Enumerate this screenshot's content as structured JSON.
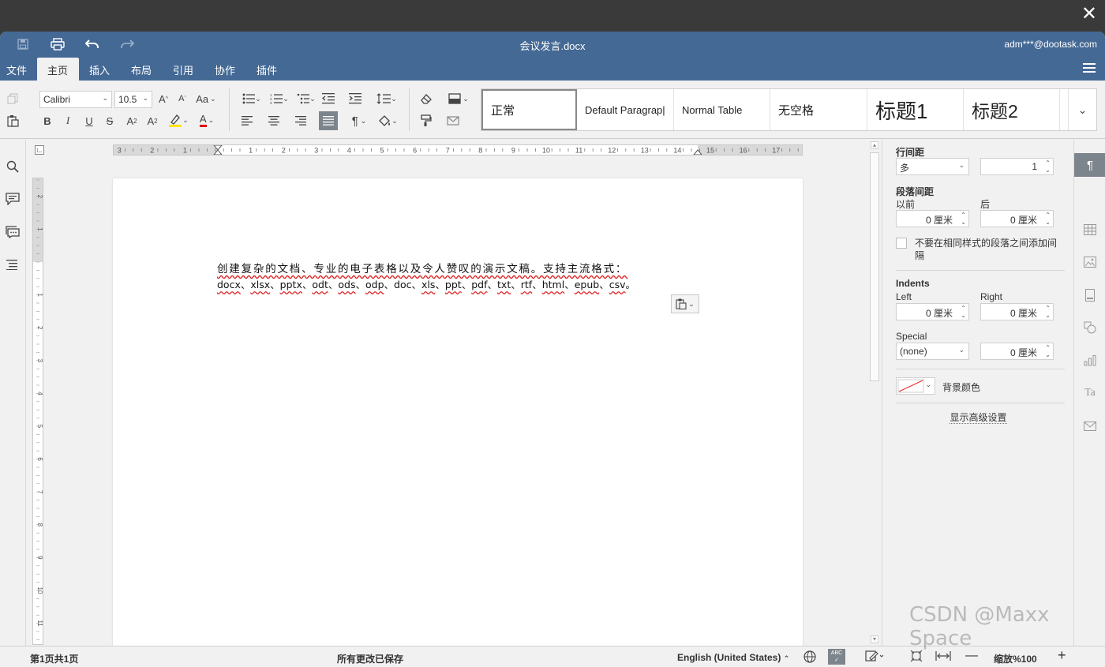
{
  "overlay": {
    "close_glyph": "✕"
  },
  "titlebar": {
    "doc_title": "会议发言.docx",
    "user": "adm***@dootask.com"
  },
  "menu": {
    "tabs": [
      "文件",
      "主页",
      "插入",
      "布局",
      "引用",
      "协作",
      "插件"
    ],
    "active_tab": "主页"
  },
  "toolbar": {
    "font_name": "Calibri",
    "font_size": "10.5",
    "styles": [
      "正常",
      "Default Paragrap|",
      "Normal Table",
      "无空格",
      "标题1",
      "标题2"
    ]
  },
  "document": {
    "line1": "创建复杂的文档、专业的电子表格以及令人赞叹的演示文稿。支持主流格式：",
    "line2_formats": [
      "docx",
      "xlsx",
      "pptx",
      "odt",
      "ods",
      "odp",
      "doc",
      "xls",
      "ppt",
      "pdf",
      "txt",
      "rtf",
      "html",
      "epub",
      "csv"
    ],
    "line2_end": "。"
  },
  "ruler": {
    "h_labels": [
      "3",
      "2",
      "1",
      "1",
      "2",
      "3",
      "4",
      "5",
      "6",
      "7",
      "8",
      "9",
      "10",
      "11",
      "12",
      "13",
      "14",
      "15",
      "16",
      "17"
    ],
    "v_labels": [
      "2",
      "1",
      "1",
      "2",
      "3",
      "4",
      "5",
      "6",
      "7",
      "8",
      "9",
      "10",
      "11"
    ]
  },
  "panel": {
    "line_spacing_label": "行间距",
    "line_spacing_mode": "多",
    "line_spacing_value": "1",
    "para_spacing_label": "段落间距",
    "before_label": "以前",
    "after_label": "后",
    "before_value": "0 厘米",
    "after_value": "0 厘米",
    "no_space_checkbox": "不要在相同样式的段落之间添加间",
    "no_space_checkbox_2": "隔",
    "indents_label": "Indents",
    "left_label": "Left",
    "right_label": "Right",
    "left_value": "0 厘米",
    "right_value": "0 厘米",
    "special_label": "Special",
    "special_mode": "(none)",
    "special_value": "0 厘米",
    "bg_color_label": "背景颜色",
    "advanced_link": "显示高级设置"
  },
  "statusbar": {
    "page_info": "第1页共1页",
    "save_status": "所有更改已保存",
    "language": "English (United States)",
    "zoom": "缩放%100"
  },
  "watermark": "CSDN @Maxx Space"
}
